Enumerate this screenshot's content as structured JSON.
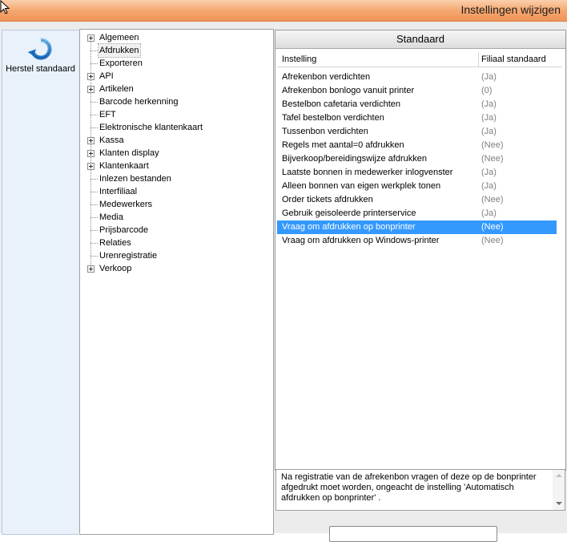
{
  "window": {
    "title": "Instellingen wijzigen"
  },
  "commands": {
    "restore_label": "Herstel standaard",
    "restore_icon": "restore-arrow-icon"
  },
  "tree": {
    "items": [
      {
        "label": "Algemeen",
        "expandable": true
      },
      {
        "label": "Afdrukken",
        "expandable": false,
        "selected": true
      },
      {
        "label": "Exporteren",
        "expandable": false
      },
      {
        "label": "API",
        "expandable": true
      },
      {
        "label": "Artikelen",
        "expandable": true
      },
      {
        "label": "Barcode herkenning",
        "expandable": false
      },
      {
        "label": "EFT",
        "expandable": false
      },
      {
        "label": "Elektronische klantenkaart",
        "expandable": false
      },
      {
        "label": "Kassa",
        "expandable": true
      },
      {
        "label": "Klanten display",
        "expandable": true
      },
      {
        "label": "Klantenkaart",
        "expandable": true
      },
      {
        "label": "Inlezen bestanden",
        "expandable": false
      },
      {
        "label": "Interfiliaal",
        "expandable": false
      },
      {
        "label": "Medewerkers",
        "expandable": false
      },
      {
        "label": "Media",
        "expandable": false
      },
      {
        "label": "Prijsbarcode",
        "expandable": false
      },
      {
        "label": "Relaties",
        "expandable": false
      },
      {
        "label": "Urenregistratie",
        "expandable": false
      },
      {
        "label": "Verkoop",
        "expandable": true
      }
    ]
  },
  "panel": {
    "title": "Standaard",
    "columns": {
      "setting": "Instelling",
      "default": "Filiaal standaard"
    },
    "rows": [
      {
        "name": "Afrekenbon verdichten",
        "value": "(Ja)"
      },
      {
        "name": "Afrekenbon bonlogo vanuit printer",
        "value": "(0)"
      },
      {
        "name": "Bestelbon cafetaria verdichten",
        "value": "(Ja)"
      },
      {
        "name": "Tafel bestelbon verdichten",
        "value": "(Ja)"
      },
      {
        "name": "Tussenbon verdichten",
        "value": "(Ja)"
      },
      {
        "name": "Regels met aantal=0 afdrukken",
        "value": "(Nee)"
      },
      {
        "name": "Bijverkoop/bereidingswijze afdrukken",
        "value": "(Nee)"
      },
      {
        "name": "Laatste bonnen in medewerker inlogvenster",
        "value": "(Ja)"
      },
      {
        "name": "Alleen bonnen van eigen werkplek tonen",
        "value": "(Ja)"
      },
      {
        "name": "Order tickets afdrukken",
        "value": "(Nee)"
      },
      {
        "name": "Gebruik geisoleerde printerservice",
        "value": "(Ja)"
      },
      {
        "name": "Vraag om afdrukken op bonprinter",
        "value": "(Nee)",
        "selected": true
      },
      {
        "name": "Vraag om afdrukken op Windows-printer",
        "value": "(Nee)"
      }
    ]
  },
  "description": "Na registratie van de afrekenbon vragen of deze op de bonprinter afgedrukt moet worden, ongeacht de instelling 'Automatisch afdrukken op bonprinter' .",
  "colors": {
    "title_bar": "#f5a871",
    "selection": "#3399ff",
    "value_text": "#808080"
  }
}
